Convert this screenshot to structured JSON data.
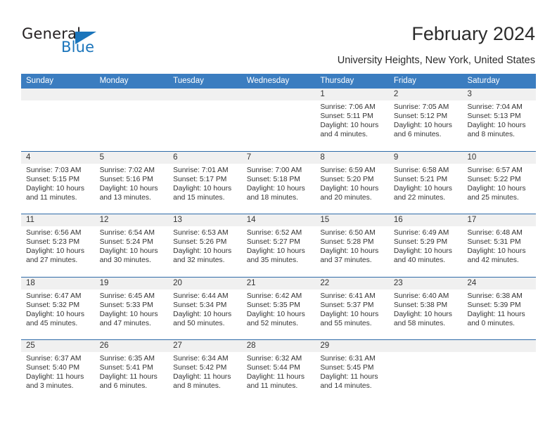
{
  "brand": {
    "name_top": "General",
    "name_bottom": "Blue",
    "accent_color": "#1b75bb"
  },
  "header": {
    "title": "February 2024",
    "subtitle": "University Heights, New York, United States"
  },
  "calendar": {
    "header_bg": "#3b7dc0",
    "row_divider_color": "#2f6ba8",
    "daynum_bg": "#f0f0f0",
    "weekdays": [
      "Sunday",
      "Monday",
      "Tuesday",
      "Wednesday",
      "Thursday",
      "Friday",
      "Saturday"
    ],
    "weeks": [
      [
        {
          "day": "",
          "sunrise": "",
          "sunset": "",
          "daylight": ""
        },
        {
          "day": "",
          "sunrise": "",
          "sunset": "",
          "daylight": ""
        },
        {
          "day": "",
          "sunrise": "",
          "sunset": "",
          "daylight": ""
        },
        {
          "day": "",
          "sunrise": "",
          "sunset": "",
          "daylight": ""
        },
        {
          "day": "1",
          "sunrise": "Sunrise: 7:06 AM",
          "sunset": "Sunset: 5:11 PM",
          "daylight": "Daylight: 10 hours and 4 minutes."
        },
        {
          "day": "2",
          "sunrise": "Sunrise: 7:05 AM",
          "sunset": "Sunset: 5:12 PM",
          "daylight": "Daylight: 10 hours and 6 minutes."
        },
        {
          "day": "3",
          "sunrise": "Sunrise: 7:04 AM",
          "sunset": "Sunset: 5:13 PM",
          "daylight": "Daylight: 10 hours and 8 minutes."
        }
      ],
      [
        {
          "day": "4",
          "sunrise": "Sunrise: 7:03 AM",
          "sunset": "Sunset: 5:15 PM",
          "daylight": "Daylight: 10 hours and 11 minutes."
        },
        {
          "day": "5",
          "sunrise": "Sunrise: 7:02 AM",
          "sunset": "Sunset: 5:16 PM",
          "daylight": "Daylight: 10 hours and 13 minutes."
        },
        {
          "day": "6",
          "sunrise": "Sunrise: 7:01 AM",
          "sunset": "Sunset: 5:17 PM",
          "daylight": "Daylight: 10 hours and 15 minutes."
        },
        {
          "day": "7",
          "sunrise": "Sunrise: 7:00 AM",
          "sunset": "Sunset: 5:18 PM",
          "daylight": "Daylight: 10 hours and 18 minutes."
        },
        {
          "day": "8",
          "sunrise": "Sunrise: 6:59 AM",
          "sunset": "Sunset: 5:20 PM",
          "daylight": "Daylight: 10 hours and 20 minutes."
        },
        {
          "day": "9",
          "sunrise": "Sunrise: 6:58 AM",
          "sunset": "Sunset: 5:21 PM",
          "daylight": "Daylight: 10 hours and 22 minutes."
        },
        {
          "day": "10",
          "sunrise": "Sunrise: 6:57 AM",
          "sunset": "Sunset: 5:22 PM",
          "daylight": "Daylight: 10 hours and 25 minutes."
        }
      ],
      [
        {
          "day": "11",
          "sunrise": "Sunrise: 6:56 AM",
          "sunset": "Sunset: 5:23 PM",
          "daylight": "Daylight: 10 hours and 27 minutes."
        },
        {
          "day": "12",
          "sunrise": "Sunrise: 6:54 AM",
          "sunset": "Sunset: 5:24 PM",
          "daylight": "Daylight: 10 hours and 30 minutes."
        },
        {
          "day": "13",
          "sunrise": "Sunrise: 6:53 AM",
          "sunset": "Sunset: 5:26 PM",
          "daylight": "Daylight: 10 hours and 32 minutes."
        },
        {
          "day": "14",
          "sunrise": "Sunrise: 6:52 AM",
          "sunset": "Sunset: 5:27 PM",
          "daylight": "Daylight: 10 hours and 35 minutes."
        },
        {
          "day": "15",
          "sunrise": "Sunrise: 6:50 AM",
          "sunset": "Sunset: 5:28 PM",
          "daylight": "Daylight: 10 hours and 37 minutes."
        },
        {
          "day": "16",
          "sunrise": "Sunrise: 6:49 AM",
          "sunset": "Sunset: 5:29 PM",
          "daylight": "Daylight: 10 hours and 40 minutes."
        },
        {
          "day": "17",
          "sunrise": "Sunrise: 6:48 AM",
          "sunset": "Sunset: 5:31 PM",
          "daylight": "Daylight: 10 hours and 42 minutes."
        }
      ],
      [
        {
          "day": "18",
          "sunrise": "Sunrise: 6:47 AM",
          "sunset": "Sunset: 5:32 PM",
          "daylight": "Daylight: 10 hours and 45 minutes."
        },
        {
          "day": "19",
          "sunrise": "Sunrise: 6:45 AM",
          "sunset": "Sunset: 5:33 PM",
          "daylight": "Daylight: 10 hours and 47 minutes."
        },
        {
          "day": "20",
          "sunrise": "Sunrise: 6:44 AM",
          "sunset": "Sunset: 5:34 PM",
          "daylight": "Daylight: 10 hours and 50 minutes."
        },
        {
          "day": "21",
          "sunrise": "Sunrise: 6:42 AM",
          "sunset": "Sunset: 5:35 PM",
          "daylight": "Daylight: 10 hours and 52 minutes."
        },
        {
          "day": "22",
          "sunrise": "Sunrise: 6:41 AM",
          "sunset": "Sunset: 5:37 PM",
          "daylight": "Daylight: 10 hours and 55 minutes."
        },
        {
          "day": "23",
          "sunrise": "Sunrise: 6:40 AM",
          "sunset": "Sunset: 5:38 PM",
          "daylight": "Daylight: 10 hours and 58 minutes."
        },
        {
          "day": "24",
          "sunrise": "Sunrise: 6:38 AM",
          "sunset": "Sunset: 5:39 PM",
          "daylight": "Daylight: 11 hours and 0 minutes."
        }
      ],
      [
        {
          "day": "25",
          "sunrise": "Sunrise: 6:37 AM",
          "sunset": "Sunset: 5:40 PM",
          "daylight": "Daylight: 11 hours and 3 minutes."
        },
        {
          "day": "26",
          "sunrise": "Sunrise: 6:35 AM",
          "sunset": "Sunset: 5:41 PM",
          "daylight": "Daylight: 11 hours and 6 minutes."
        },
        {
          "day": "27",
          "sunrise": "Sunrise: 6:34 AM",
          "sunset": "Sunset: 5:42 PM",
          "daylight": "Daylight: 11 hours and 8 minutes."
        },
        {
          "day": "28",
          "sunrise": "Sunrise: 6:32 AM",
          "sunset": "Sunset: 5:44 PM",
          "daylight": "Daylight: 11 hours and 11 minutes."
        },
        {
          "day": "29",
          "sunrise": "Sunrise: 6:31 AM",
          "sunset": "Sunset: 5:45 PM",
          "daylight": "Daylight: 11 hours and 14 minutes."
        },
        {
          "day": "",
          "sunrise": "",
          "sunset": "",
          "daylight": ""
        },
        {
          "day": "",
          "sunrise": "",
          "sunset": "",
          "daylight": ""
        }
      ]
    ]
  }
}
